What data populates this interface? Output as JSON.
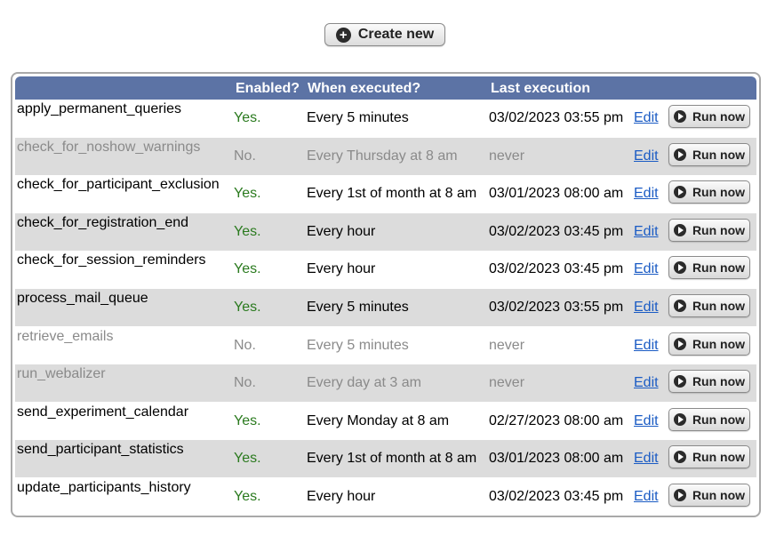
{
  "create_button": {
    "label": "Create new",
    "icon": "plus-circle-icon"
  },
  "table": {
    "headers": {
      "enabled": "Enabled?",
      "when": "When executed?",
      "last": "Last execution"
    },
    "edit_label": "Edit",
    "run_label": "Run now",
    "rows": [
      {
        "name": "apply_permanent_queries",
        "enabled": "Yes.",
        "when": "Every 5 minutes",
        "last": "03/02/2023 03:55 pm",
        "active": true
      },
      {
        "name": "check_for_noshow_warnings",
        "enabled": "No.",
        "when": "Every Thursday at 8 am",
        "last": "never",
        "active": false
      },
      {
        "name": "check_for_participant_exclusion",
        "enabled": "Yes.",
        "when": "Every 1st of month at 8 am",
        "last": "03/01/2023 08:00 am",
        "active": true
      },
      {
        "name": "check_for_registration_end",
        "enabled": "Yes.",
        "when": "Every hour",
        "last": "03/02/2023 03:45 pm",
        "active": true
      },
      {
        "name": "check_for_session_reminders",
        "enabled": "Yes.",
        "when": "Every hour",
        "last": "03/02/2023 03:45 pm",
        "active": true
      },
      {
        "name": "process_mail_queue",
        "enabled": "Yes.",
        "when": "Every 5 minutes",
        "last": "03/02/2023 03:55 pm",
        "active": true
      },
      {
        "name": "retrieve_emails",
        "enabled": "No.",
        "when": "Every 5 minutes",
        "last": "never",
        "active": false
      },
      {
        "name": "run_webalizer",
        "enabled": "No.",
        "when": "Every day at 3 am",
        "last": "never",
        "active": false
      },
      {
        "name": "send_experiment_calendar",
        "enabled": "Yes.",
        "when": "Every Monday at 8 am",
        "last": "02/27/2023 08:00 am",
        "active": true
      },
      {
        "name": "send_participant_statistics",
        "enabled": "Yes.",
        "when": "Every 1st of month at 8 am",
        "last": "03/01/2023 08:00 am",
        "active": true
      },
      {
        "name": "update_participants_history",
        "enabled": "Yes.",
        "when": "Every hour",
        "last": "03/02/2023 03:45 pm",
        "active": true
      }
    ]
  },
  "colors": {
    "header_bg": "#5c73a5",
    "enabled_yes": "#2a7a1e",
    "disabled_text": "#8a8a8a",
    "link": "#1a5bc4",
    "alt_row_bg": "#dcdcdc"
  }
}
